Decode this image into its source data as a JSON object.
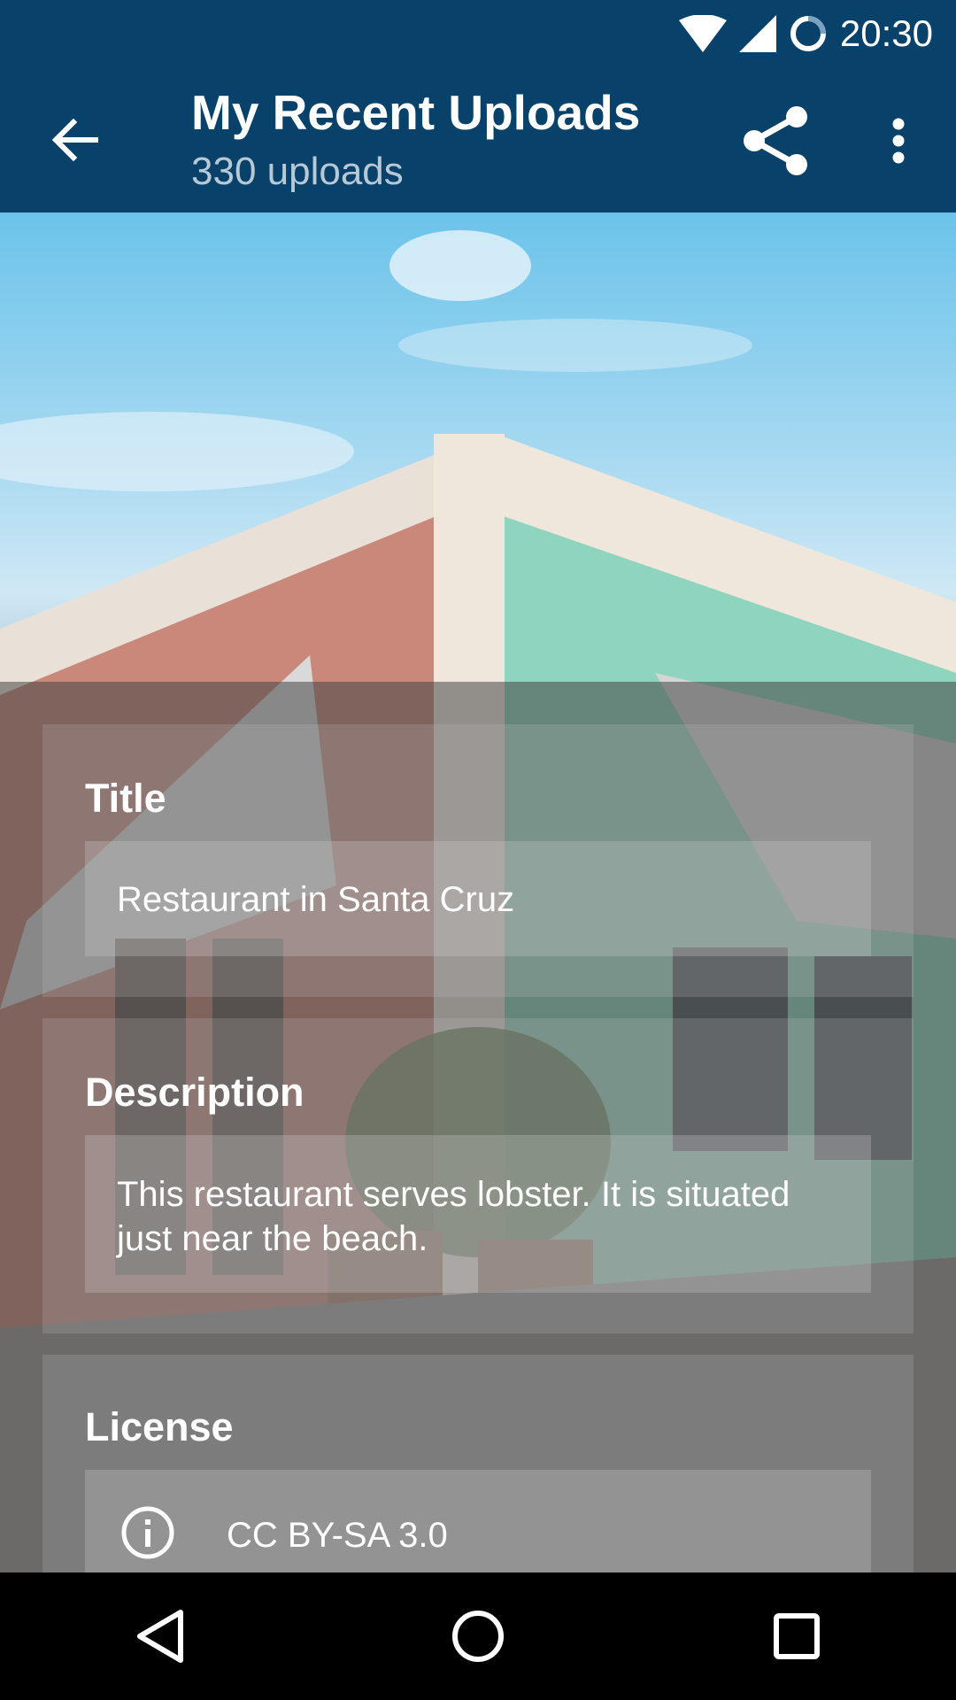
{
  "status_bar": {
    "time": "20:30",
    "icons": [
      "wifi-icon",
      "cell-signal-icon",
      "sync-icon"
    ]
  },
  "app_bar": {
    "title": "My Recent Uploads",
    "subtitle": "330 uploads",
    "icons": [
      "back-arrow-icon",
      "share-icon",
      "more-vert-icon"
    ]
  },
  "details": {
    "title_label": "Title",
    "title_value": "Restaurant in Santa Cruz",
    "description_label": "Description",
    "description_value": "This restaurant serves lobster. It is situated just near the beach.",
    "license_label": "License",
    "license_value": "CC BY-SA 3.0",
    "license_icon": "info-icon"
  },
  "nav_bar": {
    "icons": [
      "nav-back-icon",
      "nav-home-icon",
      "nav-recents-icon"
    ]
  },
  "colors": {
    "primary": "#08416a",
    "subtitle": "#b7c8d6"
  }
}
